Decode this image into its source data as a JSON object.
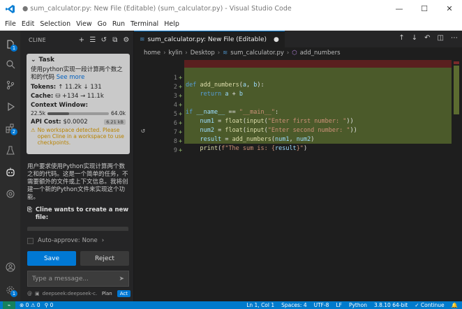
{
  "window": {
    "title": "● sum_calculator.py: New File (Editable) (sum_calculator.py) - Visual Studio Code",
    "controls": [
      "—",
      "☐",
      "✕"
    ]
  },
  "menu": [
    "File",
    "Edit",
    "Selection",
    "View",
    "Go",
    "Run",
    "Terminal",
    "Help"
  ],
  "activity": {
    "badges": {
      "explorer": "1",
      "extensions": "2"
    }
  },
  "cline": {
    "header": "CLINE",
    "task": {
      "label": "Task",
      "description": "使用python实现一段计算两个数之和的代码",
      "see_more": "See more",
      "tokens_label": "Tokens:",
      "tokens_value": "↑ 11.2k ↓ 131",
      "cache_label": "Cache:",
      "cache_value": "⛁ +134 → 11.1k",
      "context_label": "Context Window:",
      "context_used": "22.5k",
      "context_max": "64.0k",
      "context_fill": 0.35,
      "api_label": "API Cost:",
      "api_value": "$0.0002",
      "size": "6.21 kB",
      "warning": "No workspace detected. Please open Cline in a workspace to use checkpoints."
    },
    "assistant_message": "用户要求使用Python实现计算两个数之和的代码。这是一个简单的任务，不需要额外的文件或上下文信息。我将创建一个新的Python文件来实现这个功能。",
    "create_file_label": "Cline wants to create a new file:",
    "auto_approve_label": "Auto-approve:",
    "auto_approve_value": "None",
    "save_label": "Save",
    "reject_label": "Reject",
    "input_placeholder": "Type a message...",
    "model": "deepseek:deepseek-c...",
    "mode_plan": "Plan",
    "mode_act": "Act"
  },
  "editor": {
    "tab_label": "sum_calculator.py: New File (Editable)",
    "tab_dot": "●",
    "breadcrumb": [
      "home",
      "kylin",
      "Desktop",
      "sum_calculator.py",
      "add_numbers"
    ],
    "lines": [
      {
        "n": "1",
        "plus": "+",
        "code": "def add_numbers(a, b):"
      },
      {
        "n": "2",
        "plus": "+",
        "code": "    return a + b"
      },
      {
        "n": "3",
        "plus": "+",
        "code": ""
      },
      {
        "n": "4",
        "plus": "+",
        "code": "if __name__ == \"__main__\":"
      },
      {
        "n": "5",
        "plus": "+",
        "code": "    num1 = float(input(\"Enter first number: \"))"
      },
      {
        "n": "6",
        "plus": "+",
        "code": "    num2 = float(input(\"Enter second number: \"))"
      },
      {
        "n": "7",
        "plus": "+",
        "code": "    result = add_numbers(num1, num2)"
      },
      {
        "n": "8",
        "plus": "+",
        "code": "    print(f\"The sum is: {result}\")"
      },
      {
        "n": "9",
        "plus": "+",
        "code": ""
      }
    ]
  },
  "status": {
    "errors": "⊗ 0 ⚠ 0",
    "ports": "⚲ 0",
    "position": "Ln 1, Col 1",
    "spaces": "Spaces: 4",
    "encoding": "UTF-8",
    "eol": "LF",
    "language": "Python",
    "interpreter": "3.8.10 64-bit",
    "continue": "✓ Continue",
    "bell": "🔔"
  },
  "colors": {
    "accent": "#0078d4",
    "statusbar": "#007acc",
    "added": "#4b5a2a"
  }
}
